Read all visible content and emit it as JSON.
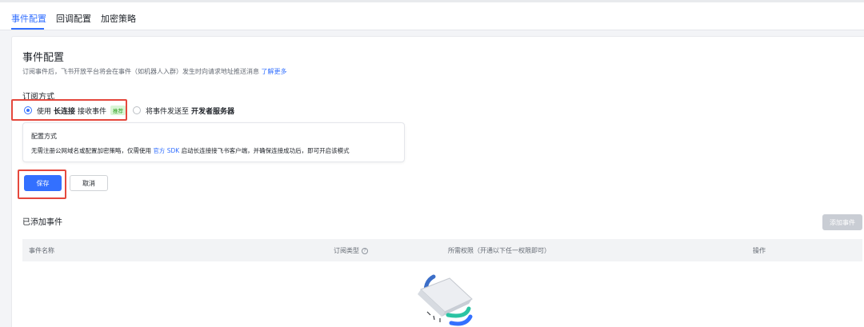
{
  "tabs": [
    {
      "label": "事件配置",
      "active": true
    },
    {
      "label": "回调配置",
      "active": false
    },
    {
      "label": "加密策略",
      "active": false
    }
  ],
  "section": {
    "title": "事件配置",
    "description": "订阅事件后，飞书开放平台将会在事件（如机器人入群）发生时向请求地址推送消息",
    "learn_more": "了解更多"
  },
  "subscription": {
    "label": "订阅方式",
    "option1": {
      "prefix": "使用",
      "bold": "长连接",
      "suffix": "接收事件",
      "tag": "推荐",
      "checked": true
    },
    "option2": {
      "prefix": "将事件发送至",
      "bold": "开发者服务器",
      "checked": false
    }
  },
  "config": {
    "title": "配置方式",
    "text_before": "无需注册公网域名或配置加密策略，仅需使用",
    "link": "官方 SDK",
    "text_after": "启动长连接接飞书客户端，并确保连接成功后，即可开启该模式"
  },
  "buttons": {
    "save": "保存",
    "cancel": "取消",
    "add_event": "添加事件"
  },
  "events": {
    "title": "已添加事件",
    "columns": [
      "事件名称",
      "订阅类型",
      "所需权限（开通以下任一权限即可）",
      "操作"
    ],
    "help_icon": "?"
  },
  "colors": {
    "accent": "#3370ff",
    "highlight": "#e5483d",
    "tag_green": "#2ea121"
  }
}
